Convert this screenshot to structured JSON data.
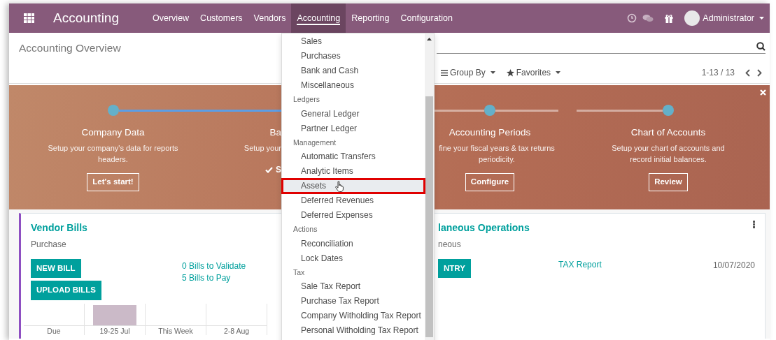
{
  "navbar": {
    "app_title": "Accounting",
    "menu": [
      {
        "label": "Overview",
        "selected": false
      },
      {
        "label": "Customers",
        "selected": false
      },
      {
        "label": "Vendors",
        "selected": false
      },
      {
        "label": "Accounting",
        "selected": true
      },
      {
        "label": "Reporting",
        "selected": false
      },
      {
        "label": "Configuration",
        "selected": false
      }
    ],
    "user": "Administrator"
  },
  "breadcrumb": "Accounting Overview",
  "search": {
    "buttons": [
      {
        "kind": "groupby",
        "label": "Group By"
      },
      {
        "kind": "favorites",
        "label": "Favorites"
      }
    ],
    "pager": "1-13 / 13"
  },
  "banner": {
    "steps": [
      {
        "title": "Company Data",
        "description": "Setup your company's data for reports headers.",
        "done": false,
        "button": "Let's start!"
      },
      {
        "title": "Ba",
        "description": "Setup your",
        "done": true,
        "done_label": "S"
      },
      {
        "title": "Accounting Periods",
        "description": "fine your fiscal years & tax returns periodicity.",
        "done": false,
        "button": "Configure"
      },
      {
        "title": "Chart of Accounts",
        "description": "Setup your chart of accounts and record initial balances.",
        "done": false,
        "button": "Review"
      }
    ]
  },
  "journals": [
    {
      "title": "Vendor Bills",
      "subtitle": "Purchase",
      "color": "#8e4fc2",
      "buttons": [
        "NEW BILL",
        "UPLOAD BILLS"
      ],
      "links": [
        "0 Bills to Validate",
        "5 Bills to Pay"
      ],
      "graph_labels": [
        "Due",
        "19-25 Jul",
        "This Week",
        "2-8 Aug"
      ]
    },
    {
      "title": "laneous Operations",
      "subtitle": "neous",
      "buttons": [
        "NTRY"
      ],
      "links": [
        "TAX Report"
      ],
      "date": "10/07/2020"
    }
  ],
  "dropdown": {
    "items": [
      {
        "kind": "item",
        "label": "Sales",
        "selected": false
      },
      {
        "kind": "item",
        "label": "Purchases",
        "selected": false
      },
      {
        "kind": "item",
        "label": "Bank and Cash",
        "selected": false
      },
      {
        "kind": "item",
        "label": "Miscellaneous",
        "selected": false
      },
      {
        "kind": "header",
        "label": "Ledgers"
      },
      {
        "kind": "item",
        "label": "General Ledger",
        "selected": false
      },
      {
        "kind": "item",
        "label": "Partner Ledger",
        "selected": false
      },
      {
        "kind": "header",
        "label": "Management"
      },
      {
        "kind": "item",
        "label": "Automatic Transfers",
        "selected": false
      },
      {
        "kind": "item",
        "label": "Analytic Items",
        "selected": false
      },
      {
        "kind": "item",
        "label": "Assets",
        "selected": true
      },
      {
        "kind": "item",
        "label": "Deferred Revenues",
        "selected": false
      },
      {
        "kind": "item",
        "label": "Deferred Expenses",
        "selected": false
      },
      {
        "kind": "header",
        "label": "Actions"
      },
      {
        "kind": "item",
        "label": "Reconciliation",
        "selected": false
      },
      {
        "kind": "item",
        "label": "Lock Dates",
        "selected": false
      },
      {
        "kind": "header",
        "label": "Tax"
      },
      {
        "kind": "item",
        "label": "Sale Tax Report",
        "selected": false
      },
      {
        "kind": "item",
        "label": "Purchase Tax Report",
        "selected": false
      },
      {
        "kind": "item",
        "label": "Company Witholding Tax Report",
        "selected": false
      },
      {
        "kind": "item",
        "label": "Personal Witholding Tax Report",
        "selected": false
      }
    ]
  }
}
